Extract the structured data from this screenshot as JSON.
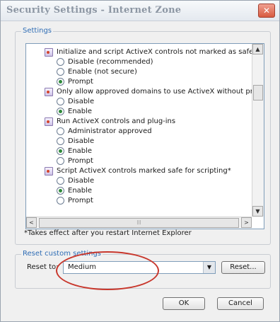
{
  "window": {
    "title": "Security Settings - Internet Zone",
    "close_glyph": "✕"
  },
  "settings": {
    "label": "Settings",
    "items": [
      {
        "type": "category",
        "text": "Initialize and script ActiveX controls not marked as safe for scripting"
      },
      {
        "type": "option",
        "text": "Disable (recommended)",
        "checked": false
      },
      {
        "type": "option",
        "text": "Enable (not secure)",
        "checked": false
      },
      {
        "type": "option",
        "text": "Prompt",
        "checked": true
      },
      {
        "type": "category",
        "text": "Only allow approved domains to use ActiveX without prompt"
      },
      {
        "type": "option",
        "text": "Disable",
        "checked": false
      },
      {
        "type": "option",
        "text": "Enable",
        "checked": true
      },
      {
        "type": "category",
        "text": "Run ActiveX controls and plug-ins"
      },
      {
        "type": "option",
        "text": "Administrator approved",
        "checked": false
      },
      {
        "type": "option",
        "text": "Disable",
        "checked": false
      },
      {
        "type": "option",
        "text": "Enable",
        "checked": true
      },
      {
        "type": "option",
        "text": "Prompt",
        "checked": false
      },
      {
        "type": "category",
        "text": "Script ActiveX controls marked safe for scripting*"
      },
      {
        "type": "option",
        "text": "Disable",
        "checked": false
      },
      {
        "type": "option",
        "text": "Enable",
        "checked": true
      },
      {
        "type": "option",
        "text": "Prompt",
        "checked": false
      }
    ],
    "scroll_up": "▲",
    "scroll_down": "▼",
    "scroll_left": "<",
    "scroll_right": ">",
    "hthumb_grip": "|||"
  },
  "note": "*Takes effect after you restart Internet Explorer",
  "reset": {
    "group_label": "Reset custom settings",
    "label": "Reset to:",
    "value": "Medium",
    "dropdown_glyph": "▼",
    "button": "Reset..."
  },
  "buttons": {
    "ok": "OK",
    "cancel": "Cancel"
  }
}
